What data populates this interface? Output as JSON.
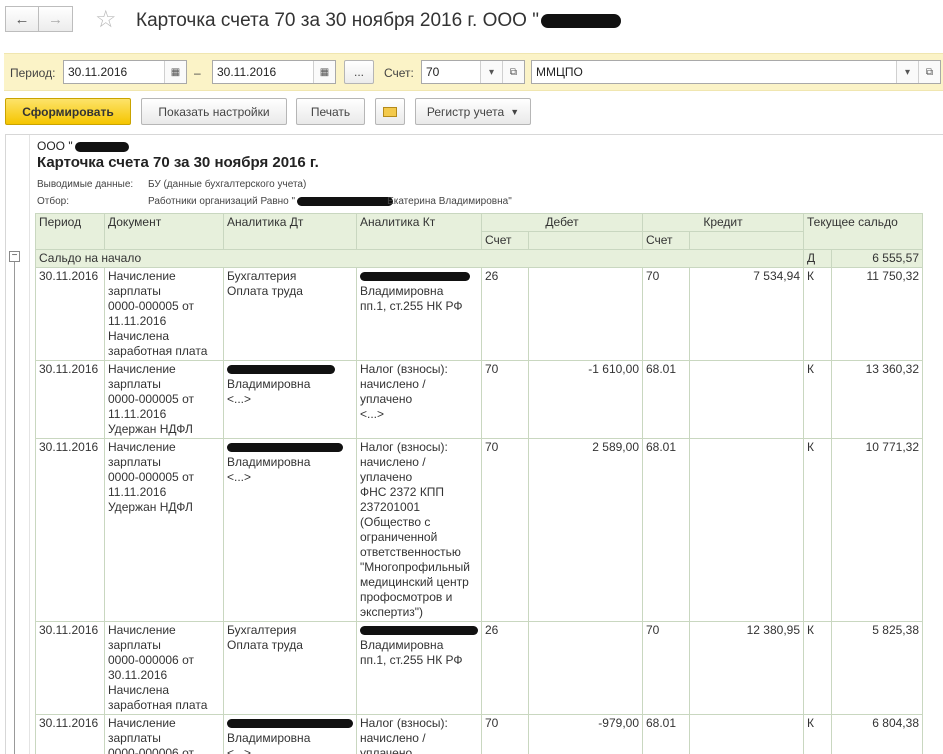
{
  "window": {
    "title": "Карточка счета 70 за 30 ноября 2016 г. ООО \""
  },
  "icons": {
    "back": "arrow-left-icon",
    "forward": "arrow-right-icon",
    "favorite": "star-icon",
    "calendar": "calendar-icon",
    "dropdown": "chevron-down-icon",
    "open": "open-window-icon",
    "email": "envelope-icon"
  },
  "period": {
    "label": "Период:",
    "from": "30.11.2016",
    "dash": "–",
    "to": "30.11.2016",
    "more": "...",
    "account_label": "Счет:",
    "account": "70",
    "org": "ММЦПО"
  },
  "toolbar": {
    "generate": "Сформировать",
    "settings": "Показать настройки",
    "print": "Печать",
    "register": "Регистр учета"
  },
  "report": {
    "org_prefix": "ООО \"",
    "title": "Карточка счета 70 за 30 ноября 2016 г.",
    "output_label": "Выводимые данные:",
    "output_value": "БУ (данные бухгалтерского учета)",
    "filter_label": "Отбор:",
    "filter_value": "Работники организаций Равно \"",
    "filter_tail": "Екатерина Владимировна\"",
    "headers": {
      "period": "Период",
      "document": "Документ",
      "an_dt": "Аналитика Дт",
      "an_kt": "Аналитика Кт",
      "debit": "Дебет",
      "credit": "Кредит",
      "balance": "Текущее сальдо",
      "account": "Счет"
    },
    "opening": {
      "label": "Сальдо на начало",
      "side": "Д",
      "value": "6 555,57"
    },
    "rows": [
      {
        "period": "30.11.2016",
        "doc": [
          "Начисление",
          "зарплаты",
          "0000-000005 от",
          "11.11.2016",
          "Начислена",
          "заработная плата"
        ],
        "dt": [
          "Бухгалтерия",
          "Оплата труда"
        ],
        "kt": [
          "",
          "Владимировна",
          "пп.1, ст.255 НК РФ"
        ],
        "dacc": "26",
        "dsum": "",
        "cacc": "70",
        "csum": "7 534,94",
        "side": "К",
        "bal": "11 750,32"
      },
      {
        "period": "30.11.2016",
        "doc": [
          "Начисление",
          "зарплаты",
          "0000-000005 от",
          "11.11.2016",
          "Удержан НДФЛ"
        ],
        "dt": [
          "",
          "Владимировна",
          "<...>"
        ],
        "kt": [
          "Налог (взносы):",
          "начислено /",
          "уплачено",
          "<...>"
        ],
        "dacc": "70",
        "dsum": "-1 610,00",
        "cacc": "68.01",
        "csum": "",
        "side": "К",
        "bal": "13 360,32"
      },
      {
        "period": "30.11.2016",
        "doc": [
          "Начисление",
          "зарплаты",
          "0000-000005 от",
          "11.11.2016",
          "Удержан НДФЛ"
        ],
        "dt": [
          "",
          "Владимировна",
          "<...>"
        ],
        "kt": [
          "Налог (взносы):",
          "начислено /",
          "уплачено",
          "ФНС 2372 КПП",
          "237201001",
          "(Общество с",
          "ограниченной",
          "ответственностью",
          "\"Многопрофильный",
          "медицинский центр",
          "профосмотров и",
          "экспертиз\")"
        ],
        "dacc": "70",
        "dsum": "2 589,00",
        "cacc": "68.01",
        "csum": "",
        "side": "К",
        "bal": "10 771,32"
      },
      {
        "period": "30.11.2016",
        "doc": [
          "Начисление",
          "зарплаты",
          "0000-000006 от",
          "30.11.2016",
          "Начислена",
          "заработная плата"
        ],
        "dt": [
          "Бухгалтерия",
          "Оплата труда"
        ],
        "kt": [
          "",
          "Владимировна",
          "пп.1, ст.255 НК РФ"
        ],
        "dacc": "26",
        "dsum": "",
        "cacc": "70",
        "csum": "12 380,95",
        "side": "К",
        "bal": "5 825,38"
      },
      {
        "period": "30.11.2016",
        "doc": [
          "Начисление",
          "зарплаты",
          "0000-000006 от"
        ],
        "dt": [
          "",
          "Владимировна",
          "<...>"
        ],
        "kt": [
          "Налог (взносы):",
          "начислено /",
          "уплачено"
        ],
        "dacc": "70",
        "dsum": "-979,00",
        "cacc": "68.01",
        "csum": "",
        "side": "К",
        "bal": "6 804,38"
      }
    ]
  }
}
